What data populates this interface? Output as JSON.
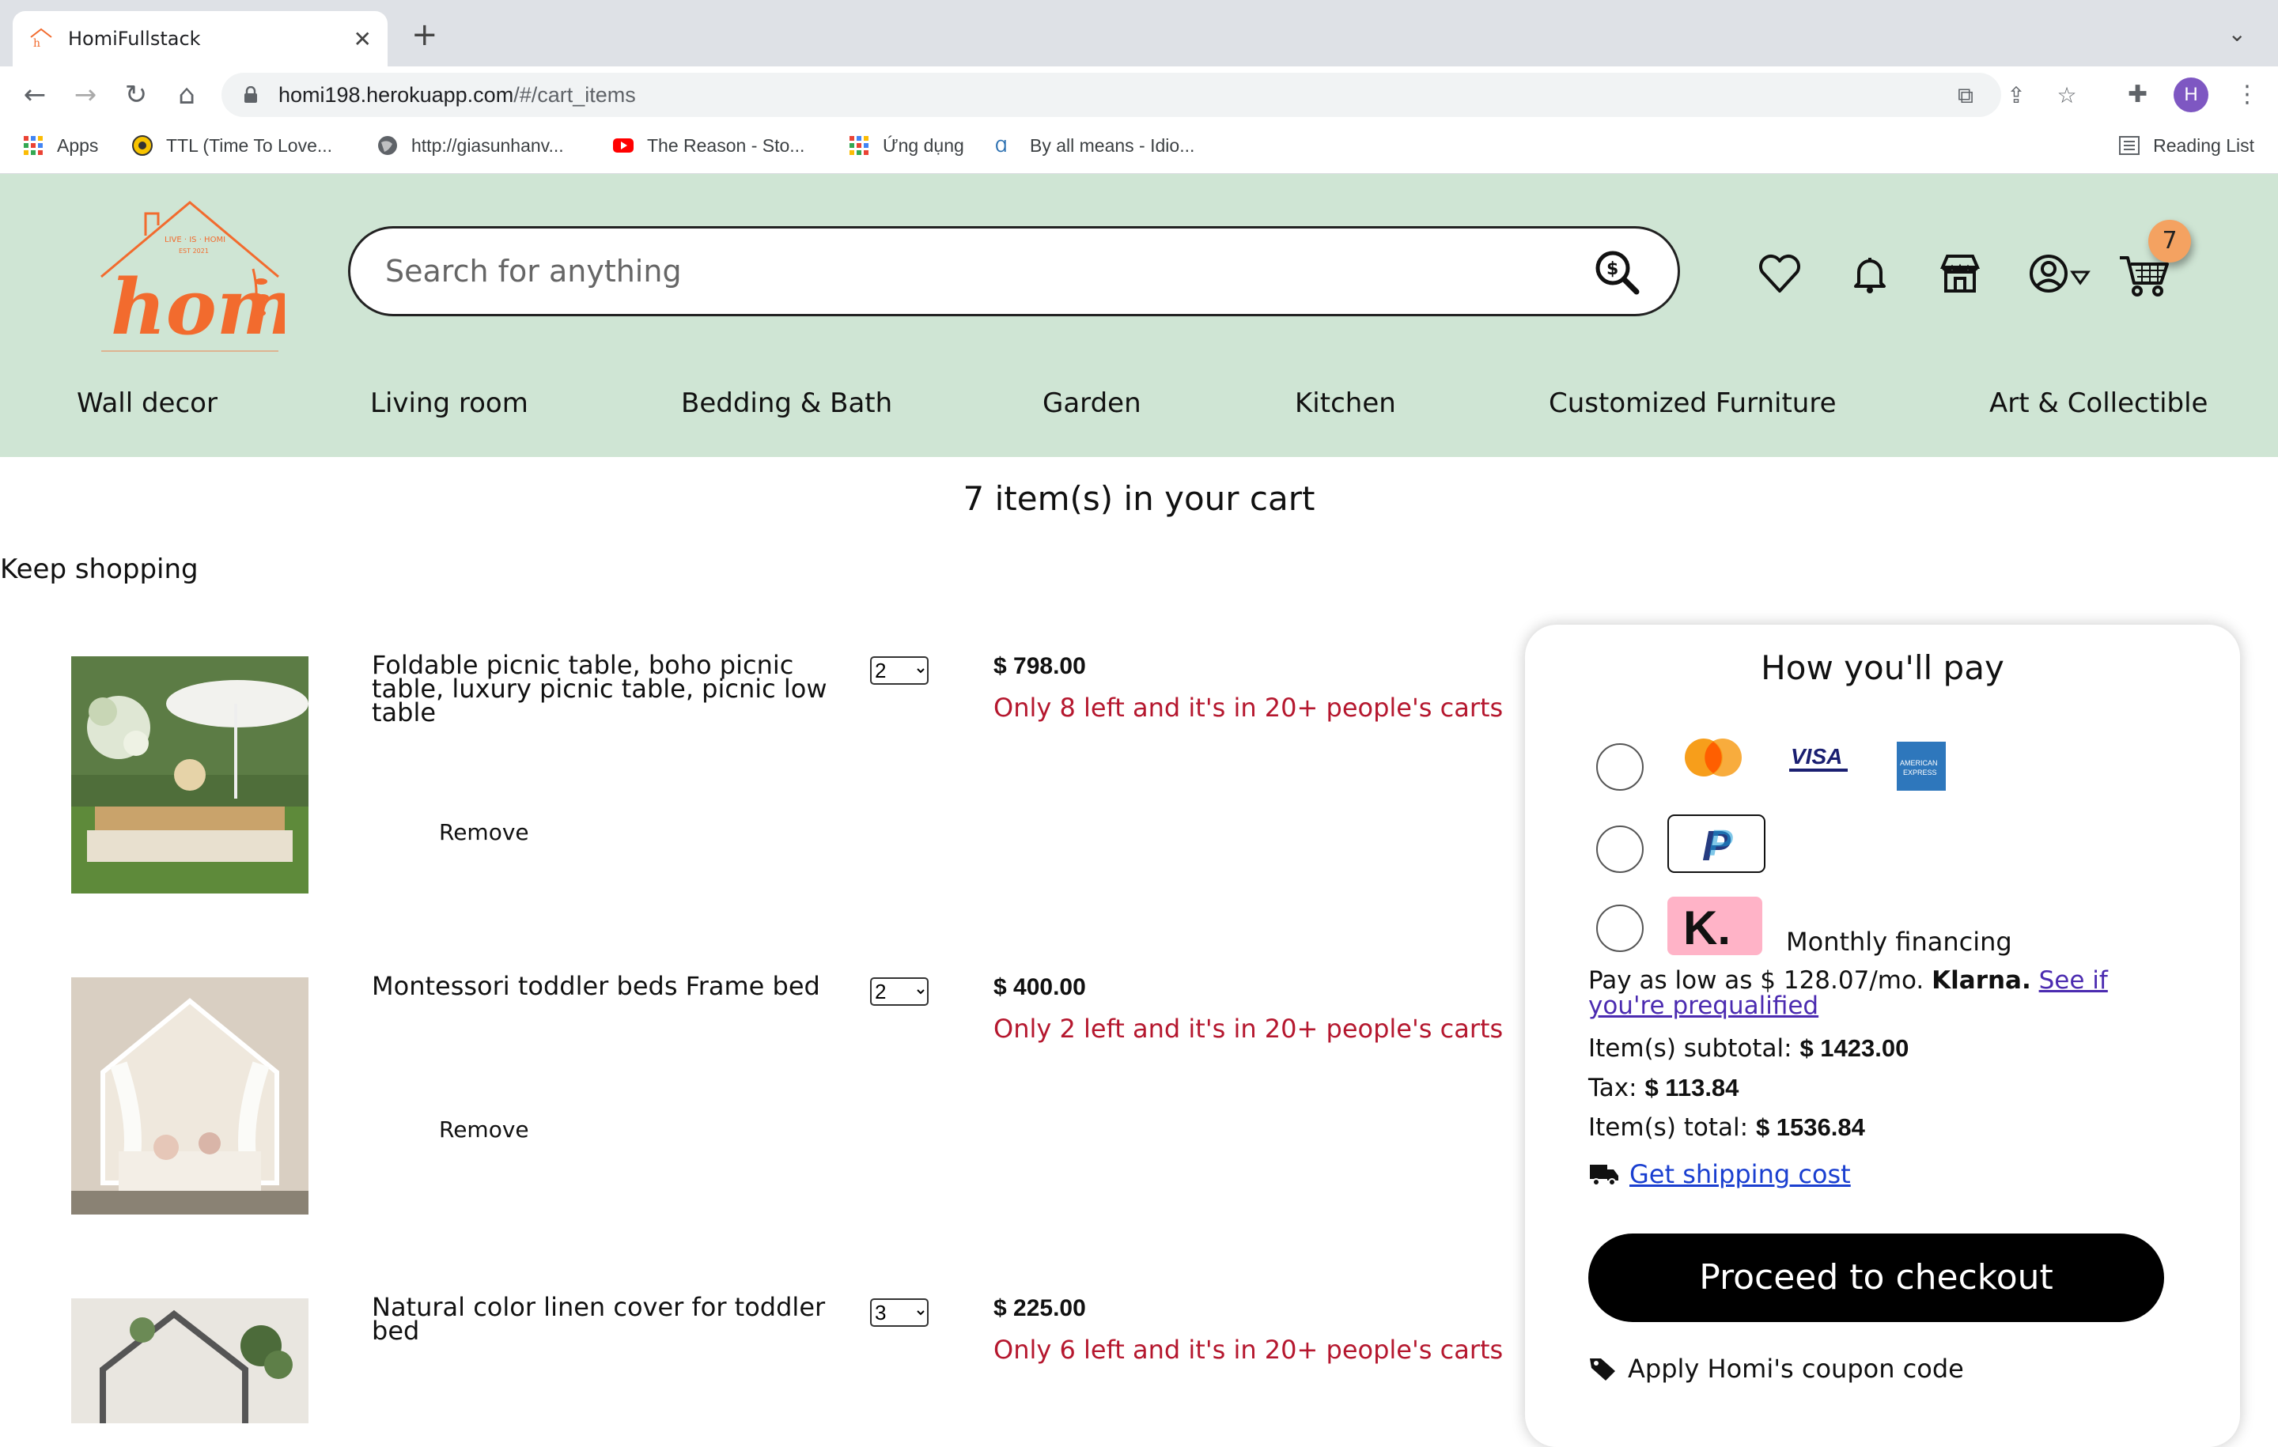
{
  "browser": {
    "tab_title": "HomiFullstack",
    "url_host": "homi198.herokuapp.com",
    "url_path": "/#/cart_items",
    "profile_initial": "H",
    "bookmarks": [
      {
        "label": "Apps",
        "icon": "apps-grid-icon"
      },
      {
        "label": "TTL (Time To Love...",
        "icon": "ttl-icon"
      },
      {
        "label": "http://giasunhanv...",
        "icon": "globe-icon"
      },
      {
        "label": "The Reason - Sto...",
        "icon": "youtube-icon"
      },
      {
        "label": "Ứng dụng",
        "icon": "apps-grid-icon"
      },
      {
        "label": "By all means - Idio...",
        "icon": "idioms-icon"
      }
    ],
    "reading_list": "Reading List"
  },
  "header": {
    "search_placeholder": "Search for anything",
    "cart_count": "7",
    "logo_text": "homi"
  },
  "categories": [
    "Wall decor",
    "Living room",
    "Bedding & Bath",
    "Garden",
    "Kitchen",
    "Customized Furniture",
    "Art & Collectible"
  ],
  "cart": {
    "title": "7 item(s) in your cart",
    "keep_shopping": "Keep shopping",
    "remove_label": "Remove",
    "items": [
      {
        "name": "Foldable picnic table, boho picnic table, luxury picnic table, picnic low table",
        "qty": "2",
        "price": "$ 798.00",
        "stock": "Only 8 left and it's in 20+ people's carts"
      },
      {
        "name": "Montessori toddler beds Frame bed",
        "qty": "2",
        "price": "$ 400.00",
        "stock": "Only 2 left and it's in 20+ people's carts"
      },
      {
        "name": "Natural color linen cover for toddler bed",
        "qty": "3",
        "price": "$ 225.00",
        "stock": "Only 6 left and it's in 20+ people's carts"
      }
    ]
  },
  "payment": {
    "title": "How you'll pay",
    "monthly_financing": "Monthly financing",
    "pay_low_prefix": "Pay as low as $ 128.07/mo.",
    "klarna": "Klarna.",
    "prequalified_link": "See if you're prequalified",
    "subtotal_label": "Item(s) subtotal:",
    "subtotal_value": "$ 1423.00",
    "tax_label": "Tax:",
    "tax_value": "$ 113.84",
    "total_label": "Item(s) total:",
    "total_value": "$ 1536.84",
    "shipping_link": "Get shipping cost",
    "checkout_button": "Proceed to checkout",
    "coupon_label": "Apply Homi's coupon code"
  },
  "colors": {
    "header_bg": "#cfe5d4",
    "brand_orange": "#f26b2e",
    "stock_red": "#b5172e",
    "badge": "#f4a261"
  }
}
